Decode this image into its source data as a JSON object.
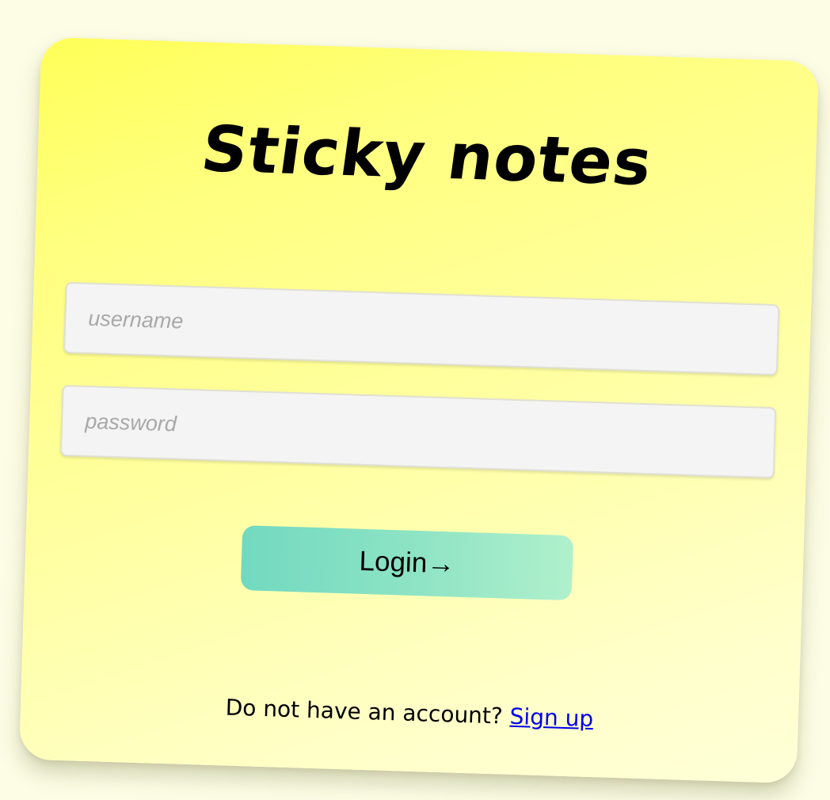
{
  "app": {
    "title": "Sticky notes"
  },
  "form": {
    "username_placeholder": "username",
    "username_value": "",
    "password_placeholder": "password",
    "password_value": "",
    "login_label": "Login→"
  },
  "footer": {
    "prompt": "Do not have an account?",
    "signup_label": "Sign up"
  },
  "colors": {
    "background": "#fdfde6",
    "note_top": "#ffff58",
    "note_bottom": "#ffffd8",
    "button_start": "#72d9c0",
    "button_end": "#b0f0cc",
    "link": "#0000ee"
  }
}
